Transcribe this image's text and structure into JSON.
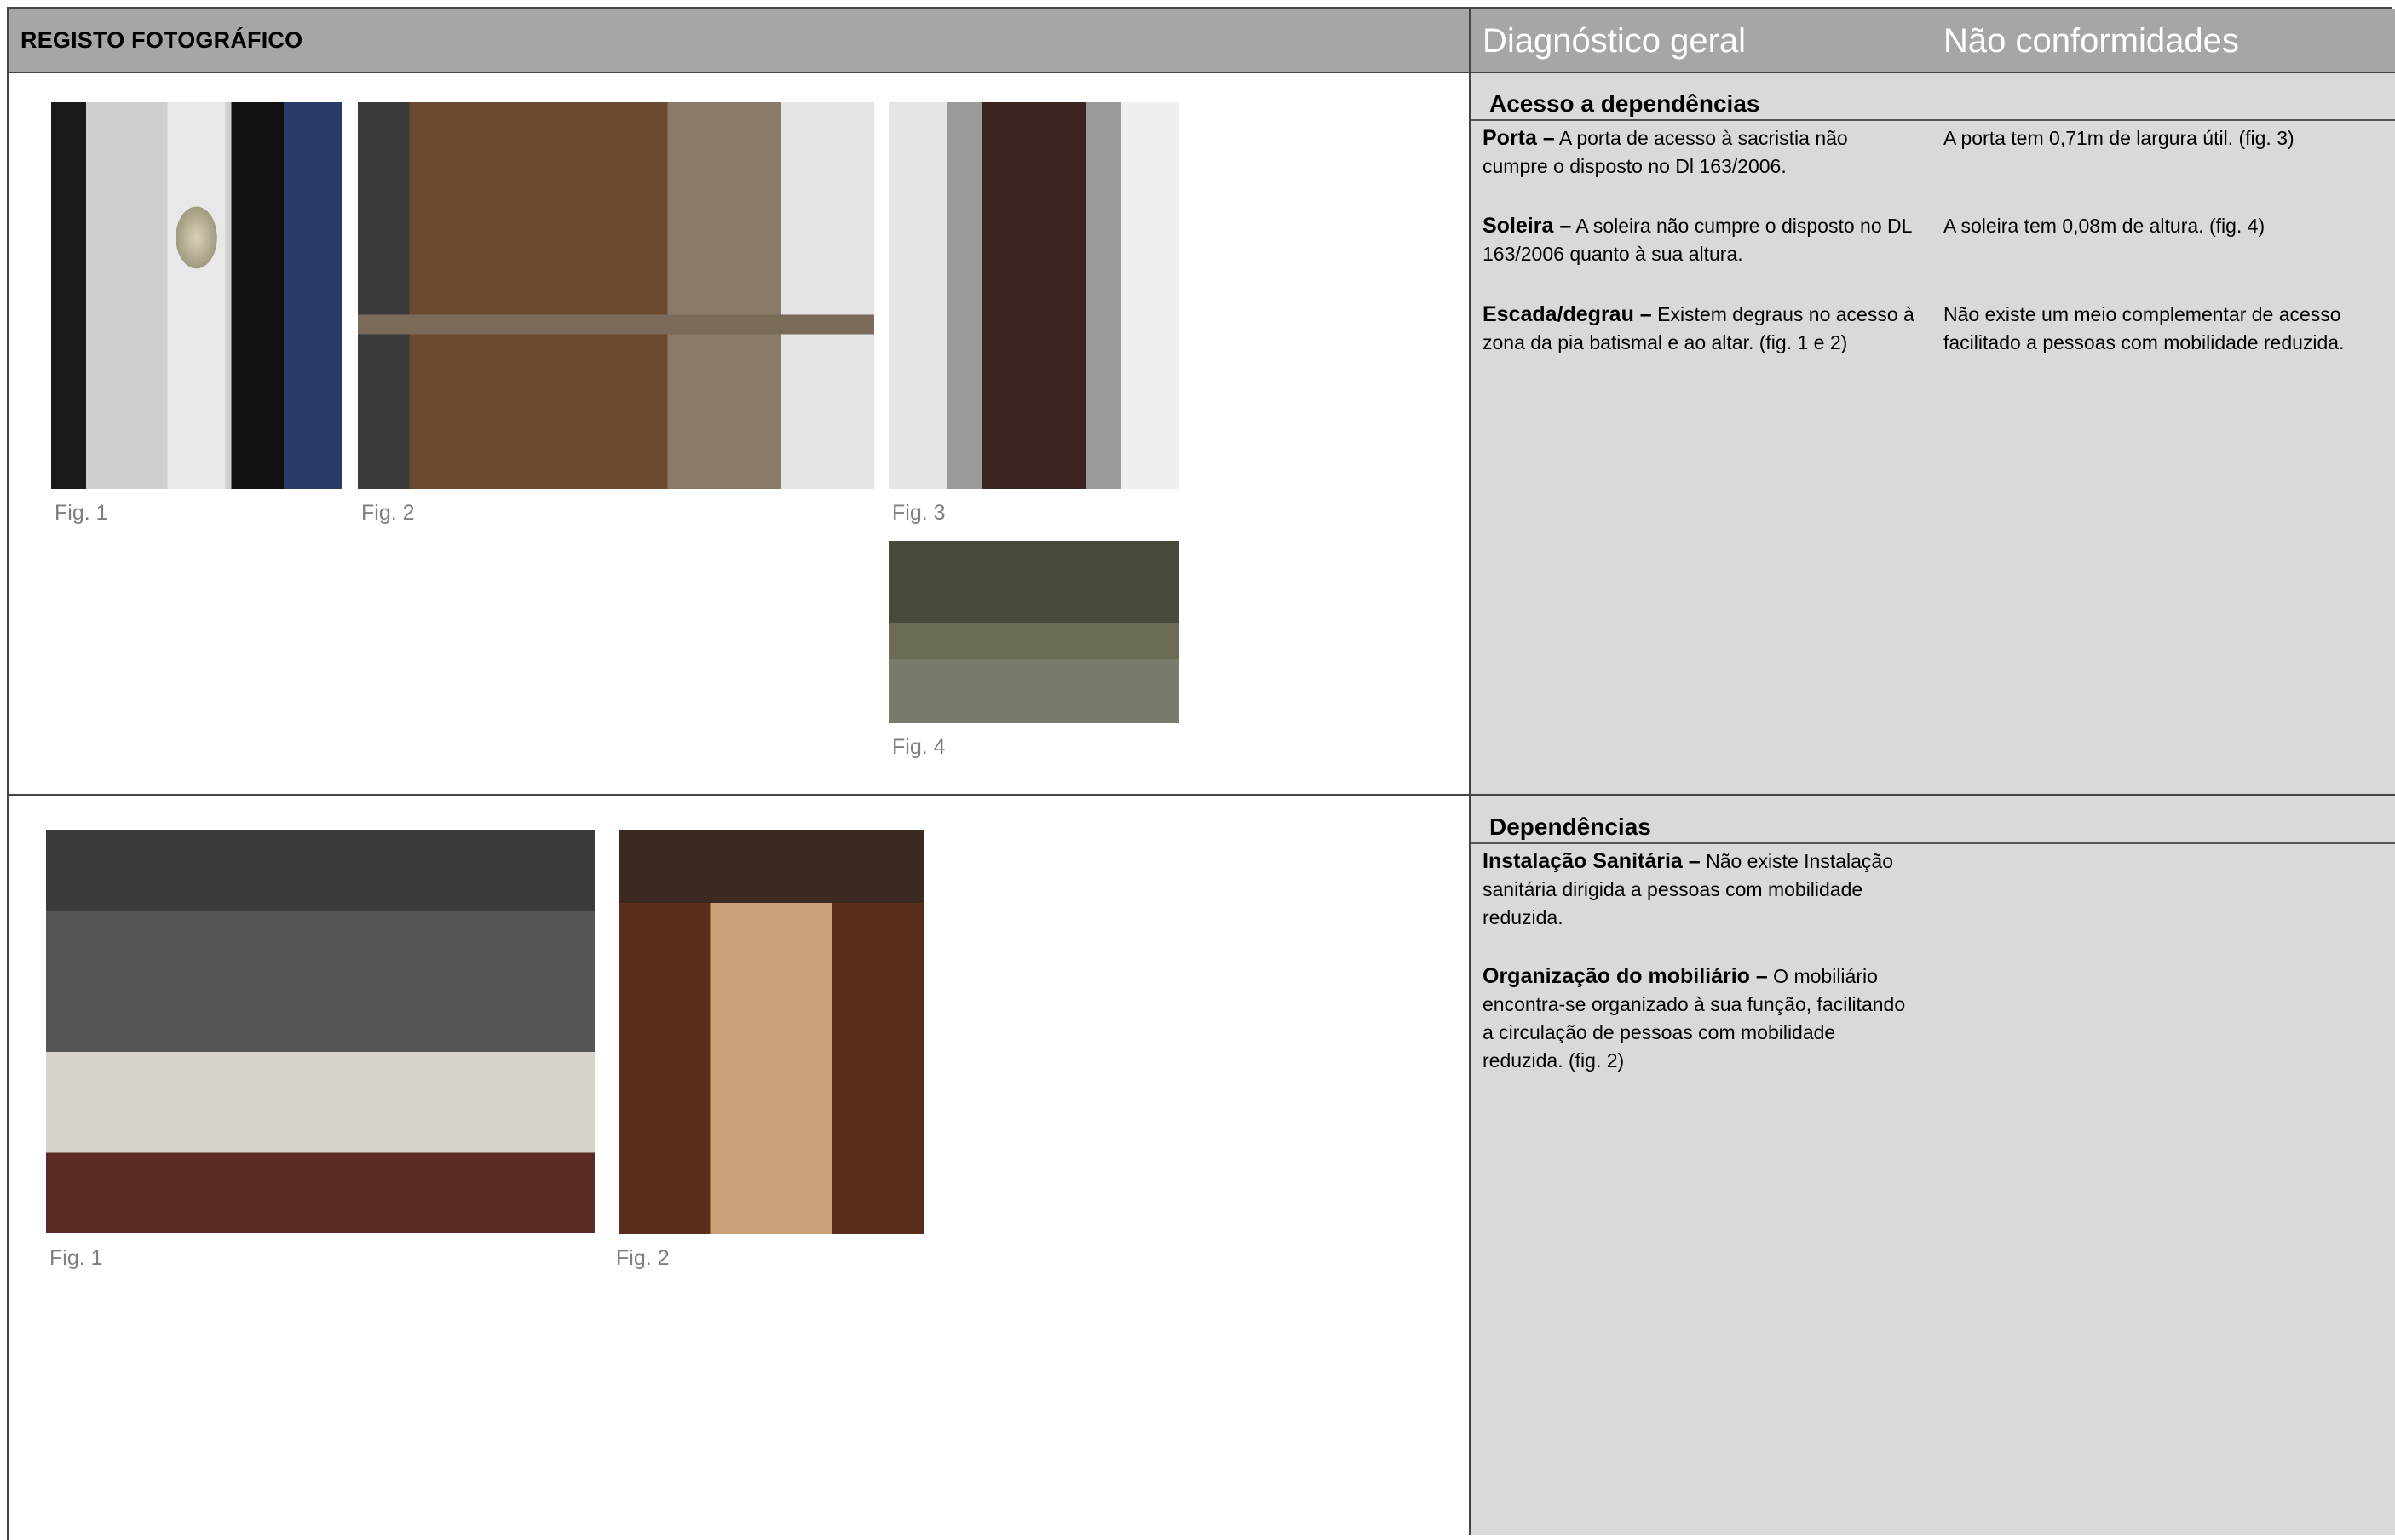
{
  "header": {
    "left_title": "REGISTO FOTOGRÁFICO",
    "col_diagnostico": "Diagnóstico geral",
    "col_nao_conformidades": "Não conformidades"
  },
  "section1": {
    "title": "Acesso a dependências",
    "items": [
      {
        "label": "Porta –",
        "text": " A porta de acesso à sacristia não cumpre o disposto no Dl 163/2006.",
        "nc": "A porta tem 0,71m de largura útil. (fig. 3)"
      },
      {
        "label": "Soleira –",
        "text": " A soleira não cumpre o disposto no DL 163/2006 quanto à sua altura.",
        "nc": "A soleira tem 0,08m de altura. (fig. 4)"
      },
      {
        "label": "Escada/degrau –",
        "text": " Existem degraus no acesso à zona da pia batismal e ao altar. (fig. 1 e 2)",
        "nc": "Não existe um meio complementar de acesso facilitado a pessoas com mobilidade reduzida."
      }
    ],
    "photos": [
      {
        "caption": "Fig. 1",
        "subject": "baptismal-font"
      },
      {
        "caption": "Fig. 2",
        "subject": "altar-step"
      },
      {
        "caption": "Fig. 3",
        "subject": "sacristy-door"
      },
      {
        "caption": "Fig. 4",
        "subject": "door-threshold"
      }
    ]
  },
  "section2": {
    "title": "Dependências",
    "items": [
      {
        "label": "Instalação Sanitária –",
        "text": " Não existe Instalação sanitária dirigida a pessoas com mobilidade reduzida."
      },
      {
        "label": "Organização do mobiliário –",
        "text": " O mobiliário encontra-se organizado à sua função, facilitando a circulação de pessoas com mobilidade reduzida. (fig. 2)"
      }
    ],
    "photos": [
      {
        "caption": "Fig. 1",
        "subject": "main-altar"
      },
      {
        "caption": "Fig. 2",
        "subject": "central-aisle"
      }
    ]
  }
}
